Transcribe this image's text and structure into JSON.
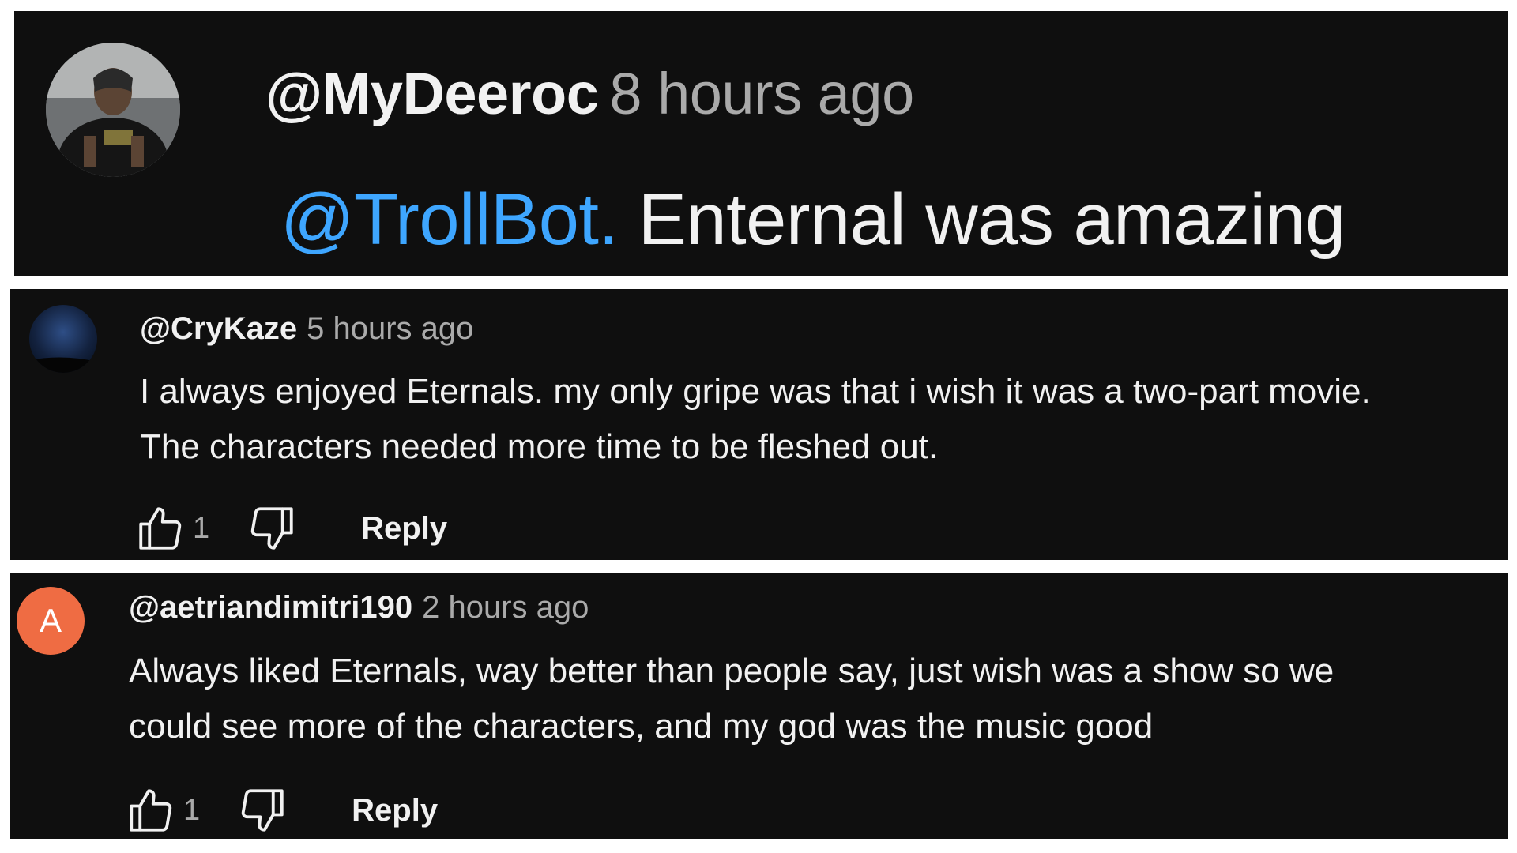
{
  "comments": [
    {
      "handle": "@MyDeeroc",
      "time": "8 hours ago",
      "mention": "@TrollBot.",
      "text": "Enternal was amazing"
    },
    {
      "handle": "@CryKaze",
      "time": "5 hours ago",
      "lines": [
        "I always enjoyed Eternals. my only gripe was that i wish it was a two-part movie.",
        "The characters needed more time to be fleshed out."
      ],
      "likes": "1",
      "reply_label": "Reply"
    },
    {
      "handle": "@aetriandimitri190",
      "time": "2 hours ago",
      "avatar_letter": "A",
      "avatar_color": "#ef6c43",
      "lines": [
        "Always liked Eternals, way better than people say, just wish was a show so we",
        "could see more of the characters, and my god was the music good"
      ],
      "likes": "1",
      "reply_label": "Reply"
    }
  ],
  "icons": {
    "like": "thumbs-up-icon",
    "dislike": "thumbs-down-icon"
  },
  "colors": {
    "background": "#0f0f0f",
    "mention": "#3ea6ff",
    "secondary_text": "#aaaaaa"
  }
}
